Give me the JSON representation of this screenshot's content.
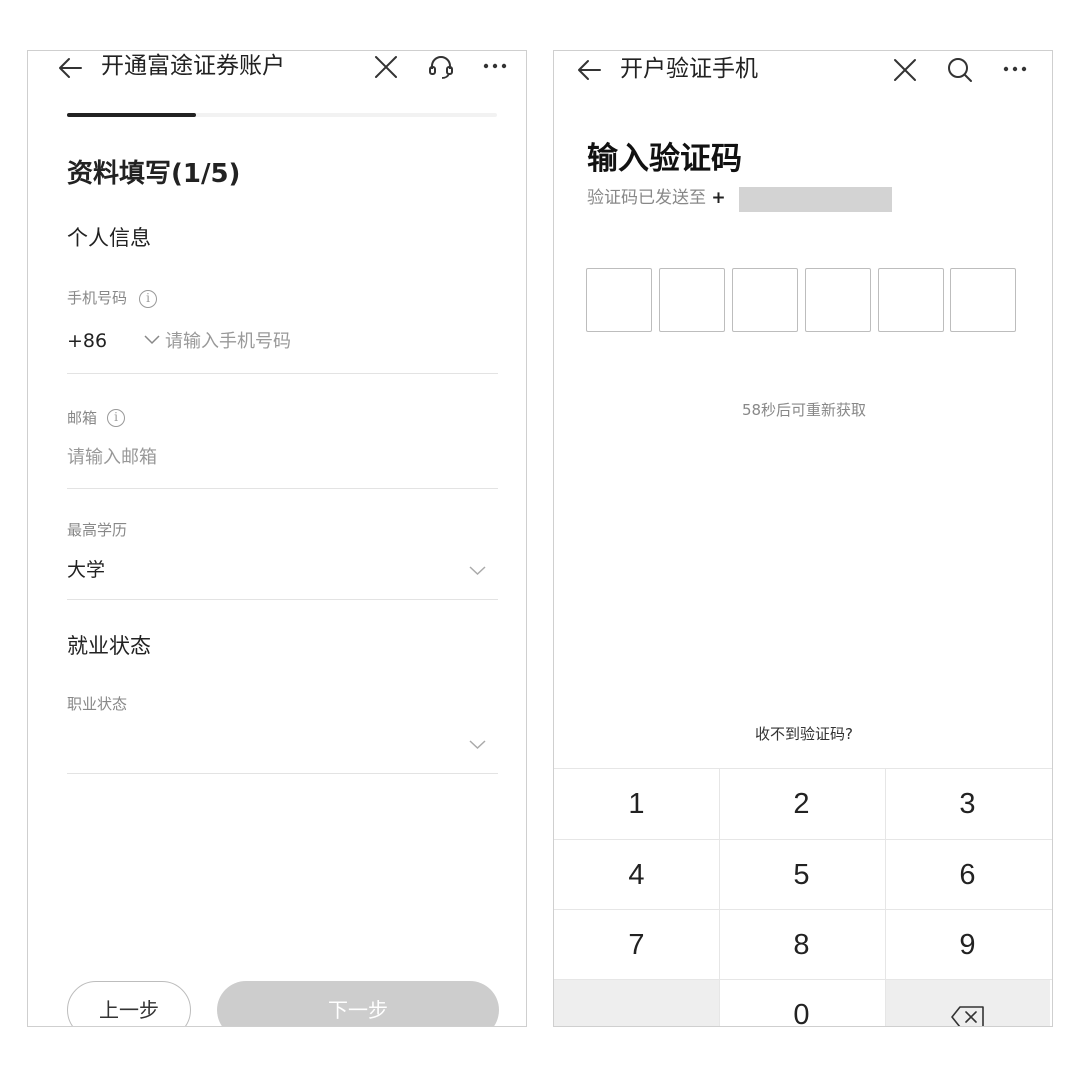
{
  "screen1": {
    "title": "开通富途证券账户",
    "progress": 0.3,
    "heading": "资料填写(1/5)",
    "section_personal": "个人信息",
    "phone_label": "手机号码",
    "phone_code": "+86",
    "phone_placeholder": "请输入手机号码",
    "email_label": "邮箱",
    "email_placeholder": "请输入邮箱",
    "education_label": "最高学历",
    "education_value": "大学",
    "section_employment": "就业状态",
    "occupation_label": "职业状态",
    "occupation_value": "",
    "prev_label": "上一步",
    "next_label": "下一步"
  },
  "screen2": {
    "title": "开户验证手机",
    "heading": "输入验证码",
    "sent_to": "验证码已发送至",
    "sent_prefix": "+",
    "code_digits": [
      "",
      "",
      "",
      "",
      "",
      ""
    ],
    "countdown": "58秒后可重新获取",
    "no_code_link": "收不到验证码?",
    "keypad": [
      "1",
      "2",
      "3",
      "4",
      "5",
      "6",
      "7",
      "8",
      "9",
      "",
      "0",
      "backspace"
    ]
  },
  "icons": {
    "back": "arrow-left-icon",
    "close": "close-icon",
    "support": "headset-icon",
    "search": "search-icon",
    "more": "more-dots-icon",
    "info": "info-icon",
    "chevron": "chevron-down-icon",
    "backspace": "backspace-icon"
  },
  "colors": {
    "text": "#222222",
    "muted": "#888888",
    "divider": "#e3e3e3",
    "button_disabled": "#cdcdcd",
    "key_dark": "#eeeeee"
  }
}
